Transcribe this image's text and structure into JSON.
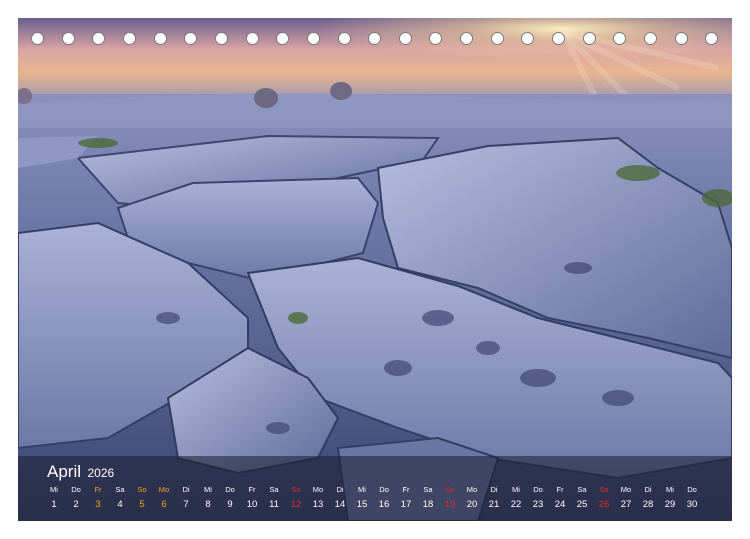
{
  "calendar": {
    "month": "April",
    "year": "2026",
    "days": [
      {
        "dow": "Mi",
        "num": "1",
        "kind": "normal"
      },
      {
        "dow": "Do",
        "num": "2",
        "kind": "normal"
      },
      {
        "dow": "Fr",
        "num": "3",
        "kind": "holiday"
      },
      {
        "dow": "Sa",
        "num": "4",
        "kind": "normal"
      },
      {
        "dow": "So",
        "num": "5",
        "kind": "holiday"
      },
      {
        "dow": "Mo",
        "num": "6",
        "kind": "holiday"
      },
      {
        "dow": "Di",
        "num": "7",
        "kind": "normal"
      },
      {
        "dow": "Mi",
        "num": "8",
        "kind": "normal"
      },
      {
        "dow": "Do",
        "num": "9",
        "kind": "normal"
      },
      {
        "dow": "Fr",
        "num": "10",
        "kind": "normal"
      },
      {
        "dow": "Sa",
        "num": "11",
        "kind": "normal"
      },
      {
        "dow": "So",
        "num": "12",
        "kind": "sunday"
      },
      {
        "dow": "Mo",
        "num": "13",
        "kind": "normal"
      },
      {
        "dow": "Di",
        "num": "14",
        "kind": "normal"
      },
      {
        "dow": "Mi",
        "num": "15",
        "kind": "normal"
      },
      {
        "dow": "Do",
        "num": "16",
        "kind": "normal"
      },
      {
        "dow": "Fr",
        "num": "17",
        "kind": "normal"
      },
      {
        "dow": "Sa",
        "num": "18",
        "kind": "normal"
      },
      {
        "dow": "So",
        "num": "19",
        "kind": "sunday"
      },
      {
        "dow": "Mo",
        "num": "20",
        "kind": "normal"
      },
      {
        "dow": "Di",
        "num": "21",
        "kind": "normal"
      },
      {
        "dow": "Mi",
        "num": "22",
        "kind": "normal"
      },
      {
        "dow": "Do",
        "num": "23",
        "kind": "normal"
      },
      {
        "dow": "Fr",
        "num": "24",
        "kind": "normal"
      },
      {
        "dow": "Sa",
        "num": "25",
        "kind": "normal"
      },
      {
        "dow": "So",
        "num": "26",
        "kind": "sunday"
      },
      {
        "dow": "Mo",
        "num": "27",
        "kind": "normal"
      },
      {
        "dow": "Di",
        "num": "28",
        "kind": "normal"
      },
      {
        "dow": "Mi",
        "num": "29",
        "kind": "normal"
      },
      {
        "dow": "Do",
        "num": "30",
        "kind": "normal"
      }
    ]
  },
  "binding": {
    "ring_count": 23
  },
  "colors": {
    "holiday": "#f2a516",
    "sunday": "#e0302a",
    "text": "#ffffff"
  }
}
